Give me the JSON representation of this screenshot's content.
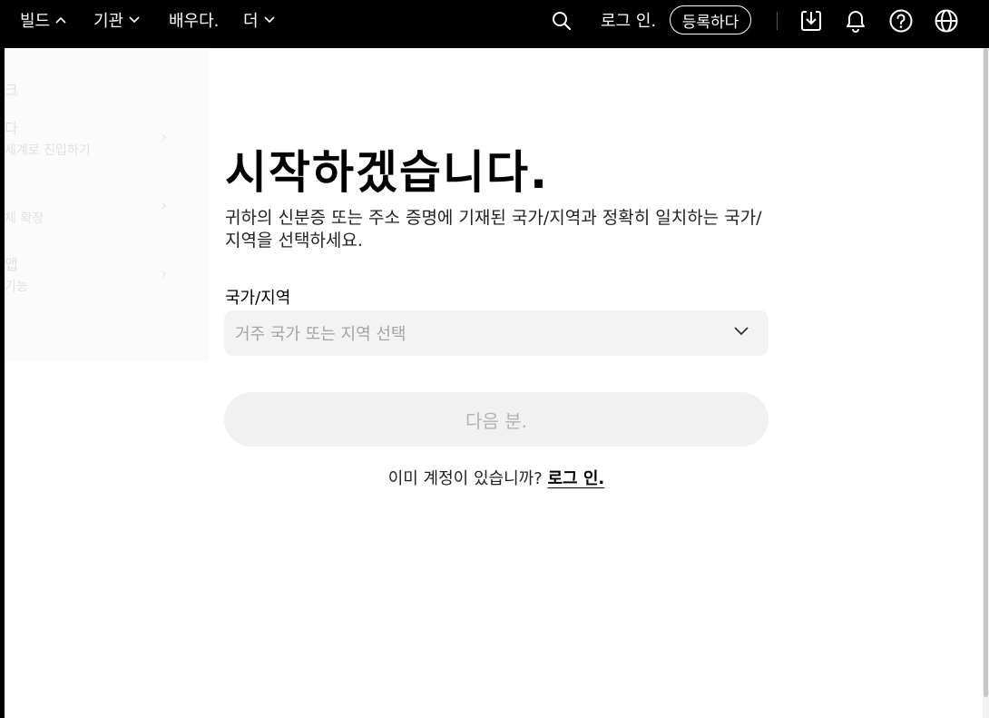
{
  "nav": {
    "build_label": "빌드",
    "org_label": "기관",
    "learn_label": "배우다.",
    "more_label": "더",
    "login_label": "로그 인.",
    "signup_label": "등록하다"
  },
  "icons": {
    "search": "search-icon",
    "download": "download-icon",
    "bell": "bell-icon",
    "help": "help-icon",
    "globe": "globe-icon"
  },
  "background_menu": {
    "items": [
      "크",
      "다",
      "세계로 진입하기",
      "체 확장",
      "앱",
      "기능"
    ]
  },
  "main": {
    "title": "시작하겠습니다.",
    "subtitle": "귀하의 신분증 또는 주소 증명에 기재된 국가/지역과 정확히 일치하는 국가/지역을 선택하세요.",
    "country_label": "국가/지역",
    "country_placeholder": "거주 국가 또는 지역 선택",
    "next_label": "다음 분.",
    "have_account_text": "이미 계정이 있습니까?",
    "login_link": "로그 인."
  },
  "colors": {
    "nav_bg": "#000000",
    "field_bg": "#f3f3f3",
    "disabled_text": "#b4b4b4"
  }
}
